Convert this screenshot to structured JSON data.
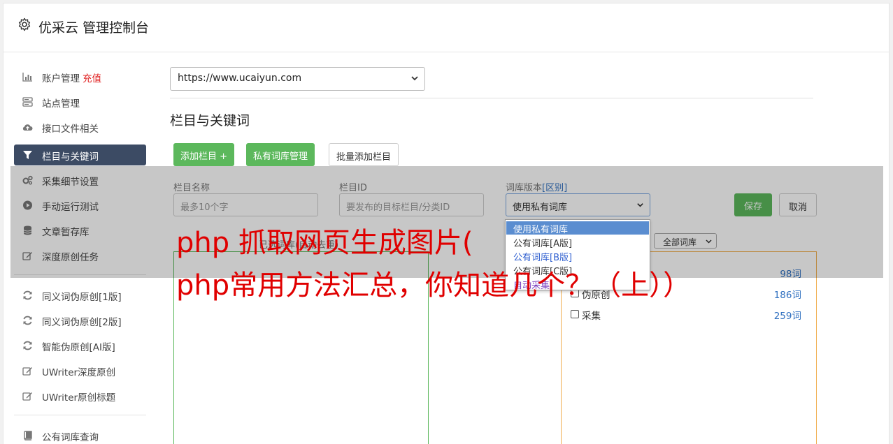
{
  "header": {
    "title": "优采云 管理控制台"
  },
  "sidebar": {
    "items": [
      {
        "label": "账户管理",
        "badge": "充值",
        "icon": "bar-chart-icon"
      },
      {
        "label": "站点管理",
        "icon": "server-icon"
      },
      {
        "label": "接口文件相关",
        "icon": "cloud-upload-icon"
      },
      {
        "label": "栏目与关键词",
        "icon": "filter-icon",
        "active": true
      },
      {
        "label": "采集细节设置",
        "icon": "cogs-icon"
      },
      {
        "label": "手动运行测试",
        "icon": "play-icon"
      },
      {
        "label": "文章暂存库",
        "icon": "database-icon"
      },
      {
        "label": "深度原创任务",
        "icon": "edit-icon"
      },
      {
        "label": "同义词伪原创[1版]",
        "icon": "refresh-icon"
      },
      {
        "label": "同义词伪原创[2版]",
        "icon": "refresh-icon"
      },
      {
        "label": "智能伪原创[AI版]",
        "icon": "refresh-icon"
      },
      {
        "label": "UWriter深度原创",
        "icon": "edit-icon"
      },
      {
        "label": "UWriter原创标题",
        "icon": "edit-icon"
      },
      {
        "label": "公有词库查询",
        "icon": "book-icon"
      }
    ]
  },
  "site_select": {
    "value": "https://www.ucaiyun.com"
  },
  "section_title": "栏目与关键词",
  "toolbar": {
    "add_column": "添加栏目 +",
    "private_lib": "私有词库管理",
    "batch_add": "批量添加栏目"
  },
  "form": {
    "name_label": "栏目名称",
    "name_placeholder": "最多10个字",
    "id_label": "栏目ID",
    "id_placeholder": "要发布的目标栏目/分类ID",
    "version_label": "词库版本",
    "version_link": "[区别]",
    "version_value": "使用私有词库",
    "save": "保存",
    "cancel": "取消"
  },
  "lists": {
    "selected_head": "已选词库(自动去重)",
    "filter_value": "全部词库",
    "libraries": [
      {
        "name": "",
        "count": "98词"
      },
      {
        "name": "伪原创",
        "count": "186词"
      },
      {
        "name": "采集",
        "count": "259词"
      }
    ]
  },
  "dropdown": {
    "options": [
      "使用私有词库",
      "公有词库[A版]",
      "公有词库[B版]",
      "公有词库[C版]",
      "自动采集"
    ]
  },
  "banner": {
    "line1": "php 抓取网页生成图片(",
    "line2": "php常用方法汇总，你知道几个？（上））"
  },
  "colors": {
    "accent_green": "#5cb85c",
    "sidebar_active": "#3c4b64",
    "banner_red": "#e00000",
    "recharge_red": "#e02020"
  }
}
